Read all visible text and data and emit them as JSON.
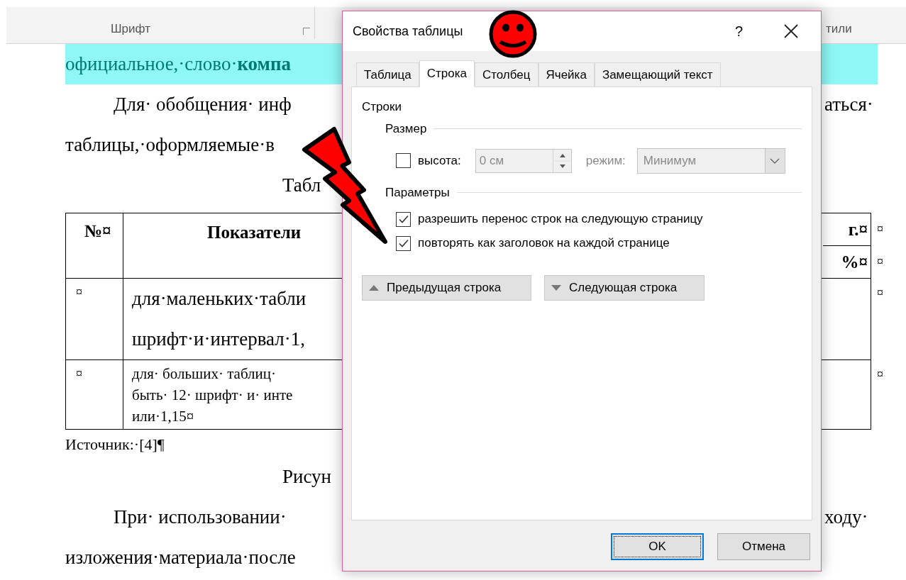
{
  "ribbon": {
    "groups": [
      {
        "label": "Шрифт",
        "launcher": true
      },
      {
        "label": "тили",
        "launcher": false
      }
    ]
  },
  "document": {
    "lines_before": [
      {
        "kind": "highlight",
        "left": "официальное,·слово·**компа**"
      },
      {
        "kind": "indent",
        "left": "Для· обобщения· инф",
        "right": "аться·"
      },
      {
        "kind": "plain",
        "left": "таблицы,·оформляемые·в"
      },
      {
        "kind": "center",
        "left": "Табл"
      }
    ],
    "table": {
      "header": {
        "number": "№¤",
        "label": "Показатели",
        "right": [
          "г.¤",
          "%¤"
        ]
      },
      "rows": [
        {
          "number": "¤",
          "lines": [
            "для·маленьких·табли",
            "шрифт·и·интервал·1,"
          ],
          "small": false
        },
        {
          "number": "¤",
          "lines": [
            "для· больших· таблиц·",
            "быть· 12· шрифт· и· инте",
            "или·1,15¤"
          ],
          "small": true
        }
      ],
      "row_end_mark": "¤"
    },
    "source": "Источник:·[4]¶",
    "lines_after": [
      {
        "kind": "center",
        "left": "Рисун"
      },
      {
        "kind": "indent",
        "left": "При· использовании·",
        "right": "ходу·"
      },
      {
        "kind": "plain",
        "left": "изложения·материала·после"
      }
    ]
  },
  "dialog": {
    "title": "Свойства таблицы",
    "help": "?",
    "tabs": [
      {
        "label": "Таблица",
        "selected": false
      },
      {
        "label": "Строка",
        "selected": true
      },
      {
        "label": "Столбец",
        "selected": false
      },
      {
        "label": "Ячейка",
        "selected": false
      },
      {
        "label": "Замещающий текст",
        "selected": false
      }
    ],
    "section": "Строки",
    "size": {
      "label": "Размер",
      "height": {
        "label": "высота:",
        "checked": false,
        "value": "0 см",
        "disabled": true
      },
      "mode": {
        "label": "режим:",
        "value": "Минимум",
        "disabled": true
      }
    },
    "options": {
      "label": "Параметры",
      "items": [
        {
          "label": "разрешить перенос строк на следующую страницу",
          "checked": true
        },
        {
          "label": "повторять как заголовок на каждой странице",
          "checked": true
        }
      ]
    },
    "nav": [
      {
        "kind": "previous",
        "label": "Предыдущая строка"
      },
      {
        "kind": "next",
        "label": "Следующая строка"
      }
    ],
    "buttons": [
      {
        "label": "OK",
        "default": true
      },
      {
        "label": "Отмена",
        "default": false
      }
    ]
  }
}
